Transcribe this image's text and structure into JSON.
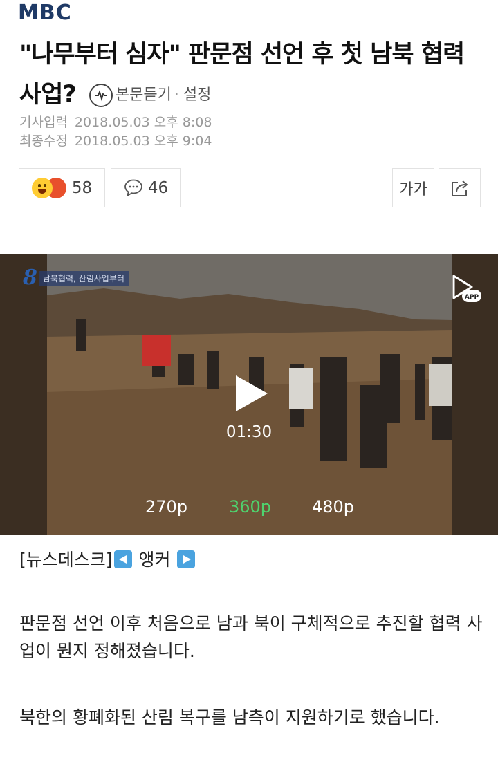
{
  "brand": {
    "logo_text": "MBC",
    "logo_color": "#1f3a66"
  },
  "article": {
    "title": "\"나무부터 심자\" 판문점 선언 후 첫 남북 협력 사업?",
    "listen_label": "본문듣기",
    "listen_sep": "·",
    "settings_label": "설정",
    "input_label": "기사입력",
    "input_date": "2018.05.03 오후 8:08",
    "modified_label": "최종수정",
    "modified_date": "2018.05.03 오후 9:04"
  },
  "actions": {
    "reaction_count": "58",
    "comment_count": "46",
    "font_size_label": "가가",
    "reaction_icons": [
      "happy-face-icon",
      "angry-face-icon"
    ],
    "comment_icon": "speech-bubble-icon",
    "share_icon": "share-icon"
  },
  "video": {
    "channel_number": "8",
    "caption_text": "남북협력, 산림사업부터",
    "duration": "01:30",
    "qualities": [
      "270p",
      "360p",
      "480p"
    ],
    "selected_quality": "360p",
    "app_label": "APP",
    "accent_color": "#4fd36e"
  },
  "body": {
    "newsdesk": "[뉴스데스크]",
    "anchor": "앵커",
    "paragraph1": "판문점 선언 이후 처음으로 남과 북이 구체적으로 추진할 협력 사업이 뭔지 정해졌습니다.",
    "paragraph2": "북한의 황폐화된 산림 복구를 남측이 지원하기로 했습니다."
  }
}
